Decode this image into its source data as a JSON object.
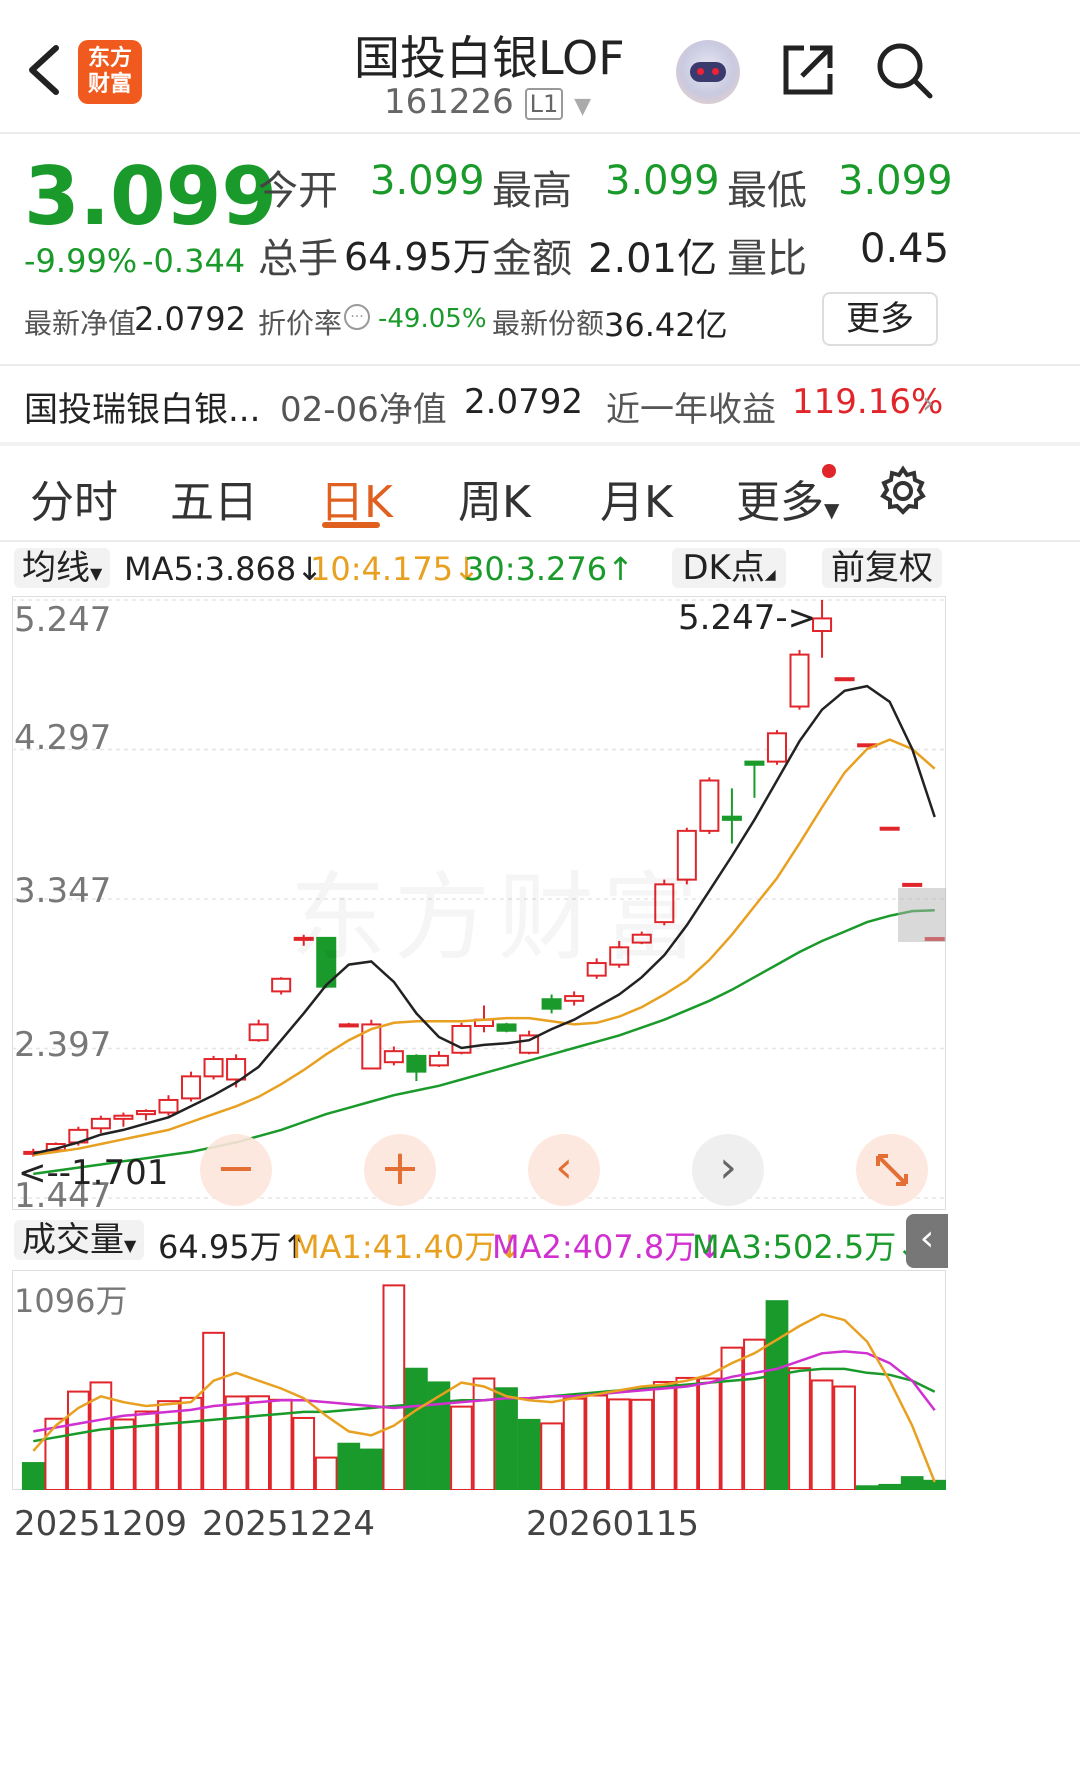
{
  "header": {
    "title": "国投白银LOF",
    "code": "161226",
    "level": "L1",
    "logo_text": [
      "东方",
      "财富"
    ]
  },
  "quote": {
    "price": "3.099",
    "change_pct": "-9.99%",
    "change_abs": "-0.344",
    "open_label": "今开",
    "open": "3.099",
    "high_label": "最高",
    "high": "3.099",
    "low_label": "最低",
    "low": "3.099",
    "vol_label": "总手",
    "vol": "64.95万",
    "amount_label": "金额",
    "amount": "2.01亿",
    "ratio_label": "量比",
    "ratio": "0.45",
    "nav_label": "最新净值",
    "nav": "2.0792",
    "discount_label": "折价率",
    "discount": "-49.05%",
    "shares_label": "最新份额",
    "shares": "36.42亿",
    "more_button": "更多"
  },
  "related": {
    "name": "国投瑞银白银...",
    "nav_label": "02-06净值",
    "nav": "2.0792",
    "ret_label": "近一年收益",
    "ret": "119.16%"
  },
  "tabs": [
    "分时",
    "五日",
    "日K",
    "周K",
    "月K",
    "更多"
  ],
  "active_tab": 2,
  "ma_bar": {
    "selector": "均线",
    "ma5": "MA5:3.868",
    "ma10": "10:4.175",
    "ma30": "30:3.276",
    "dk": "DK点",
    "adjust": "前复权"
  },
  "price_axis": [
    "5.247",
    "4.297",
    "3.347",
    "2.397",
    "1.447"
  ],
  "annotations": {
    "high": "5.247->",
    "low": "<--1.701"
  },
  "watermark": "东方财富",
  "vol_bar": {
    "selector": "成交量",
    "vol": "64.95万",
    "ma1": "MA1:41.40万",
    "ma2": "MA2:407.8万",
    "ma3": "MA3:502.5万",
    "axis_max": "1096万"
  },
  "dates": [
    "20251209",
    "20251224",
    "20260115"
  ],
  "colors": {
    "up": "#e0252b",
    "down": "#1a9a2a",
    "ma5": "#222222",
    "ma10": "#e8a020",
    "ma30": "#1a9a2a",
    "vma2": "#d030d0"
  },
  "chart_data": {
    "type": "candlestick",
    "y_range": [
      1.447,
      5.247
    ],
    "candles": [
      [
        1.73,
        1.76,
        1.71,
        1.74
      ],
      [
        1.75,
        1.8,
        1.74,
        1.79
      ],
      [
        1.8,
        1.9,
        1.78,
        1.88
      ],
      [
        1.89,
        1.97,
        1.86,
        1.95
      ],
      [
        1.95,
        1.99,
        1.9,
        1.97
      ],
      [
        1.98,
        2.01,
        1.94,
        2.0
      ],
      [
        1.99,
        2.1,
        1.97,
        2.07
      ],
      [
        2.08,
        2.25,
        2.06,
        2.22
      ],
      [
        2.22,
        2.35,
        2.2,
        2.33
      ],
      [
        2.2,
        2.36,
        2.15,
        2.33
      ],
      [
        2.45,
        2.58,
        2.44,
        2.55
      ],
      [
        2.76,
        2.85,
        2.74,
        2.84
      ],
      [
        3.1,
        3.12,
        3.05,
        3.1
      ],
      [
        3.1,
        3.1,
        2.78,
        2.79
      ],
      [
        2.55,
        2.56,
        2.54,
        2.55
      ],
      [
        2.27,
        2.58,
        2.27,
        2.55
      ],
      [
        2.31,
        2.41,
        2.29,
        2.38
      ],
      [
        2.35,
        2.36,
        2.19,
        2.25
      ],
      [
        2.29,
        2.38,
        2.28,
        2.35
      ],
      [
        2.37,
        2.56,
        2.36,
        2.54
      ],
      [
        2.54,
        2.67,
        2.5,
        2.58
      ],
      [
        2.55,
        2.56,
        2.5,
        2.51
      ],
      [
        2.37,
        2.51,
        2.36,
        2.48
      ],
      [
        2.71,
        2.74,
        2.62,
        2.65
      ],
      [
        2.7,
        2.76,
        2.67,
        2.73
      ],
      [
        2.86,
        2.97,
        2.84,
        2.94
      ],
      [
        2.93,
        3.08,
        2.91,
        3.04
      ],
      [
        3.07,
        3.14,
        3.06,
        3.12
      ],
      [
        3.2,
        3.47,
        3.18,
        3.44
      ],
      [
        3.47,
        3.8,
        3.44,
        3.78
      ],
      [
        3.78,
        4.12,
        3.76,
        4.1
      ],
      [
        3.87,
        4.05,
        3.7,
        3.85
      ],
      [
        4.22,
        4.22,
        3.99,
        4.2
      ],
      [
        4.22,
        4.42,
        4.2,
        4.4
      ],
      [
        4.57,
        4.93,
        4.55,
        4.9
      ],
      [
        5.05,
        5.247,
        4.88,
        5.13
      ],
      [
        4.75,
        4.75,
        4.75,
        4.75
      ],
      [
        4.33,
        4.33,
        4.33,
        4.33
      ],
      [
        3.8,
        3.8,
        3.8,
        3.8
      ],
      [
        3.443,
        3.443,
        3.443,
        3.443
      ],
      [
        3.099,
        3.099,
        3.099,
        3.099
      ]
    ],
    "ma5": [
      1.73,
      1.76,
      1.8,
      1.85,
      1.88,
      1.92,
      1.96,
      2.03,
      2.1,
      2.18,
      2.28,
      2.45,
      2.62,
      2.8,
      2.93,
      2.95,
      2.82,
      2.62,
      2.47,
      2.4,
      2.42,
      2.43,
      2.45,
      2.52,
      2.58,
      2.66,
      2.74,
      2.85,
      2.99,
      3.18,
      3.4,
      3.62,
      3.85,
      4.1,
      4.35,
      4.55,
      4.67,
      4.7,
      4.6,
      4.3,
      3.868
    ],
    "ma10": [
      1.72,
      1.74,
      1.76,
      1.79,
      1.82,
      1.85,
      1.88,
      1.93,
      1.98,
      2.03,
      2.09,
      2.17,
      2.26,
      2.36,
      2.45,
      2.52,
      2.56,
      2.57,
      2.57,
      2.57,
      2.58,
      2.59,
      2.59,
      2.57,
      2.55,
      2.56,
      2.6,
      2.66,
      2.74,
      2.83,
      2.96,
      3.12,
      3.3,
      3.48,
      3.7,
      3.93,
      4.15,
      4.3,
      4.36,
      4.3,
      4.175
    ],
    "ma30": [
      1.6,
      1.62,
      1.64,
      1.66,
      1.68,
      1.7,
      1.72,
      1.74,
      1.77,
      1.8,
      1.84,
      1.88,
      1.93,
      1.98,
      2.02,
      2.06,
      2.1,
      2.13,
      2.16,
      2.2,
      2.24,
      2.28,
      2.32,
      2.36,
      2.4,
      2.44,
      2.48,
      2.53,
      2.58,
      2.64,
      2.7,
      2.77,
      2.85,
      2.93,
      3.01,
      3.08,
      3.14,
      3.2,
      3.24,
      3.27,
      3.276
    ],
    "volume_range": [
      0,
      1096
    ],
    "volume": [
      138,
      365,
      504,
      551,
      361,
      402,
      455,
      472,
      805,
      479,
      480,
      462,
      369,
      166,
      237,
      207,
      1048,
      621,
      551,
      427,
      571,
      521,
      359,
      341,
      468,
      484,
      464,
      462,
      553,
      574,
      571,
      729,
      770,
      967,
      624,
      561,
      530,
      19,
      26,
      66,
      47
    ],
    "volume_dir": [
      "d",
      "u",
      "u",
      "u",
      "u",
      "u",
      "u",
      "u",
      "u",
      "u",
      "u",
      "u",
      "u",
      "u",
      "d",
      "d",
      "u",
      "d",
      "d",
      "u",
      "u",
      "d",
      "d",
      "u",
      "u",
      "u",
      "u",
      "u",
      "u",
      "u",
      "u",
      "u",
      "u",
      "d",
      "u",
      "u",
      "u",
      "d",
      "d",
      "d",
      "d"
    ],
    "vma1": [
      200,
      330,
      420,
      480,
      450,
      430,
      440,
      450,
      560,
      600,
      560,
      520,
      470,
      380,
      300,
      280,
      330,
      410,
      480,
      550,
      530,
      480,
      460,
      450,
      470,
      490,
      510,
      530,
      540,
      560,
      590,
      650,
      700,
      770,
      840,
      900,
      870,
      760,
      560,
      330,
      41
    ],
    "vma2": [
      300,
      320,
      340,
      360,
      380,
      390,
      400,
      410,
      430,
      440,
      450,
      460,
      460,
      450,
      440,
      430,
      420,
      430,
      440,
      450,
      460,
      470,
      470,
      480,
      480,
      490,
      500,
      510,
      520,
      530,
      550,
      580,
      600,
      620,
      660,
      700,
      710,
      700,
      650,
      560,
      408
    ],
    "vma3": [
      250,
      270,
      290,
      310,
      320,
      330,
      340,
      350,
      360,
      370,
      380,
      390,
      400,
      400,
      410,
      420,
      430,
      440,
      450,
      460,
      460,
      470,
      470,
      480,
      490,
      500,
      510,
      520,
      530,
      540,
      550,
      560,
      570,
      590,
      610,
      620,
      620,
      600,
      590,
      560,
      503
    ]
  }
}
